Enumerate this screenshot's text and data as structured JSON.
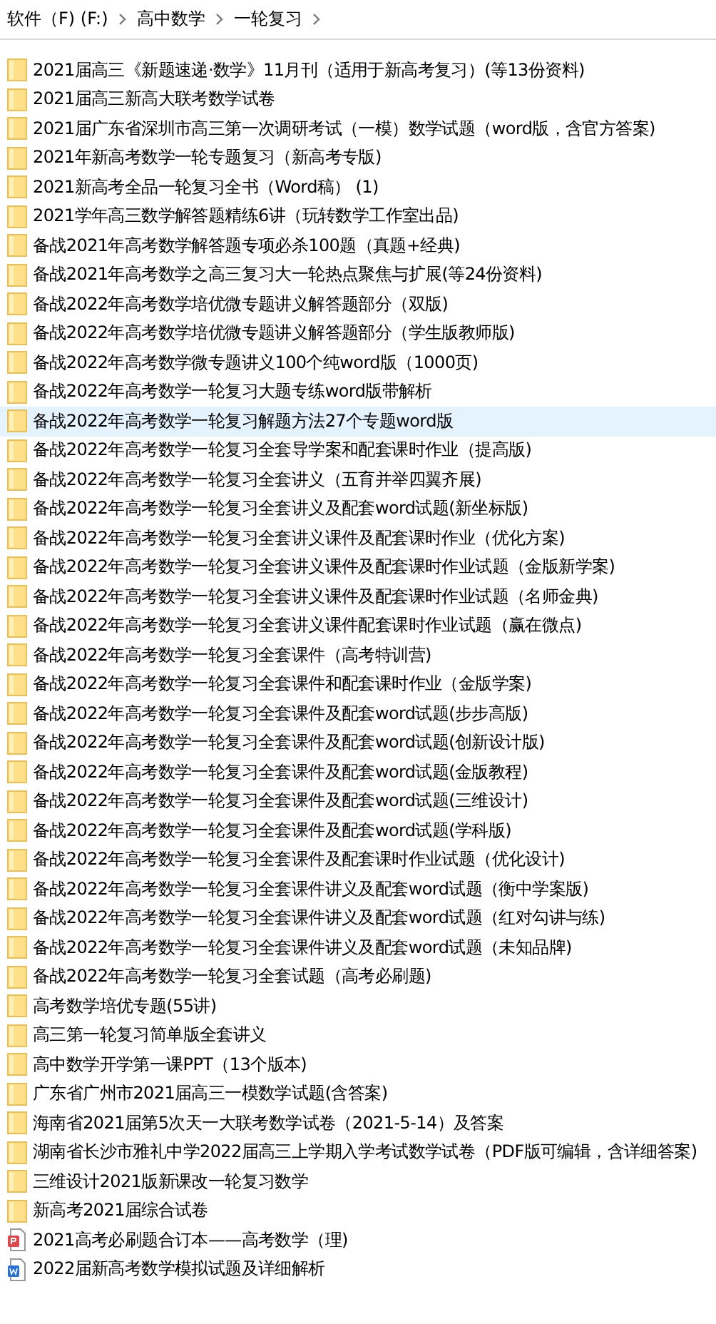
{
  "breadcrumb": [
    "软件（F) (F:)",
    "高中数学",
    "一轮复习"
  ],
  "files": [
    {
      "name": "2021届高三《新题速递·数学》11月刊（适用于新高考复习）(等13份资料)",
      "kind": "folder",
      "selected": false
    },
    {
      "name": "2021届高三新高大联考数学试卷",
      "kind": "folder",
      "selected": false
    },
    {
      "name": "2021届广东省深圳市高三第一次调研考试（一模）数学试题（word版，含官方答案)",
      "kind": "folder",
      "selected": false
    },
    {
      "name": "2021年新高考数学一轮专题复习（新高考专版)",
      "kind": "folder",
      "selected": false
    },
    {
      "name": "2021新高考全品一轮复习全书（Word稿） (1)",
      "kind": "folder",
      "selected": false
    },
    {
      "name": "2021学年高三数学解答题精练6讲（玩转数学工作室出品)",
      "kind": "folder",
      "selected": false
    },
    {
      "name": "备战2021年高考数学解答题专项必杀100题（真题+经典)",
      "kind": "folder",
      "selected": false
    },
    {
      "name": "备战2021年高考数学之高三复习大一轮热点聚焦与扩展(等24份资料)",
      "kind": "folder",
      "selected": false
    },
    {
      "name": "备战2022年高考数学培优微专题讲义解答题部分（双版)",
      "kind": "folder",
      "selected": false
    },
    {
      "name": "备战2022年高考数学培优微专题讲义解答题部分（学生版教师版)",
      "kind": "folder",
      "selected": false
    },
    {
      "name": "备战2022年高考数学微专题讲义100个纯word版（1000页)",
      "kind": "folder",
      "selected": false
    },
    {
      "name": "备战2022年高考数学一轮复习大题专练word版带解析",
      "kind": "folder",
      "selected": false
    },
    {
      "name": "备战2022年高考数学一轮复习解题方法27个专题word版",
      "kind": "folder",
      "selected": true
    },
    {
      "name": "备战2022年高考数学一轮复习全套导学案和配套课时作业（提高版)",
      "kind": "folder",
      "selected": false
    },
    {
      "name": "备战2022年高考数学一轮复习全套讲义（五育并举四翼齐展)",
      "kind": "folder",
      "selected": false
    },
    {
      "name": "备战2022年高考数学一轮复习全套讲义及配套word试题(新坐标版)",
      "kind": "folder",
      "selected": false
    },
    {
      "name": "备战2022年高考数学一轮复习全套讲义课件及配套课时作业（优化方案)",
      "kind": "folder",
      "selected": false
    },
    {
      "name": "备战2022年高考数学一轮复习全套讲义课件及配套课时作业试题（金版新学案)",
      "kind": "folder",
      "selected": false
    },
    {
      "name": "备战2022年高考数学一轮复习全套讲义课件及配套课时作业试题（名师金典)",
      "kind": "folder",
      "selected": false
    },
    {
      "name": "备战2022年高考数学一轮复习全套讲义课件配套课时作业试题（赢在微点)",
      "kind": "folder",
      "selected": false
    },
    {
      "name": "备战2022年高考数学一轮复习全套课件（高考特训营)",
      "kind": "folder",
      "selected": false
    },
    {
      "name": "备战2022年高考数学一轮复习全套课件和配套课时作业（金版学案)",
      "kind": "folder",
      "selected": false
    },
    {
      "name": "备战2022年高考数学一轮复习全套课件及配套word试题(步步高版)",
      "kind": "folder",
      "selected": false
    },
    {
      "name": "备战2022年高考数学一轮复习全套课件及配套word试题(创新设计版)",
      "kind": "folder",
      "selected": false
    },
    {
      "name": "备战2022年高考数学一轮复习全套课件及配套word试题(金版教程)",
      "kind": "folder",
      "selected": false
    },
    {
      "name": "备战2022年高考数学一轮复习全套课件及配套word试题(三维设计)",
      "kind": "folder",
      "selected": false
    },
    {
      "name": "备战2022年高考数学一轮复习全套课件及配套word试题(学科版)",
      "kind": "folder",
      "selected": false
    },
    {
      "name": "备战2022年高考数学一轮复习全套课件及配套课时作业试题（优化设计)",
      "kind": "folder",
      "selected": false
    },
    {
      "name": "备战2022年高考数学一轮复习全套课件讲义及配套word试题（衡中学案版)",
      "kind": "folder",
      "selected": false
    },
    {
      "name": "备战2022年高考数学一轮复习全套课件讲义及配套word试题（红对勾讲与练)",
      "kind": "folder",
      "selected": false
    },
    {
      "name": "备战2022年高考数学一轮复习全套课件讲义及配套word试题（未知品牌)",
      "kind": "folder",
      "selected": false
    },
    {
      "name": "备战2022年高考数学一轮复习全套试题（高考必刷题)",
      "kind": "folder",
      "selected": false
    },
    {
      "name": "高考数学培优专题(55讲)",
      "kind": "folder",
      "selected": false
    },
    {
      "name": "高三第一轮复习简单版全套讲义",
      "kind": "folder",
      "selected": false
    },
    {
      "name": "高中数学开学第一课PPT（13个版本)",
      "kind": "folder",
      "selected": false
    },
    {
      "name": "广东省广州市2021届高三一模数学试题(含答案)",
      "kind": "folder",
      "selected": false
    },
    {
      "name": "海南省2021届第5次天一大联考数学试卷（2021-5-14）及答案",
      "kind": "folder",
      "selected": false
    },
    {
      "name": "湖南省长沙市雅礼中学2022届高三上学期入学考试数学试卷（PDF版可编辑，含详细答案)",
      "kind": "folder",
      "selected": false
    },
    {
      "name": "三维设计2021版新课改一轮复习数学",
      "kind": "folder",
      "selected": false
    },
    {
      "name": "新高考2021届综合试卷",
      "kind": "folder",
      "selected": false
    },
    {
      "name": "2021高考必刷题合订本——高考数学（理)",
      "kind": "pdf",
      "selected": false
    },
    {
      "name": "2022届新高考数学模拟试题及详细解析",
      "kind": "word",
      "selected": false
    }
  ]
}
